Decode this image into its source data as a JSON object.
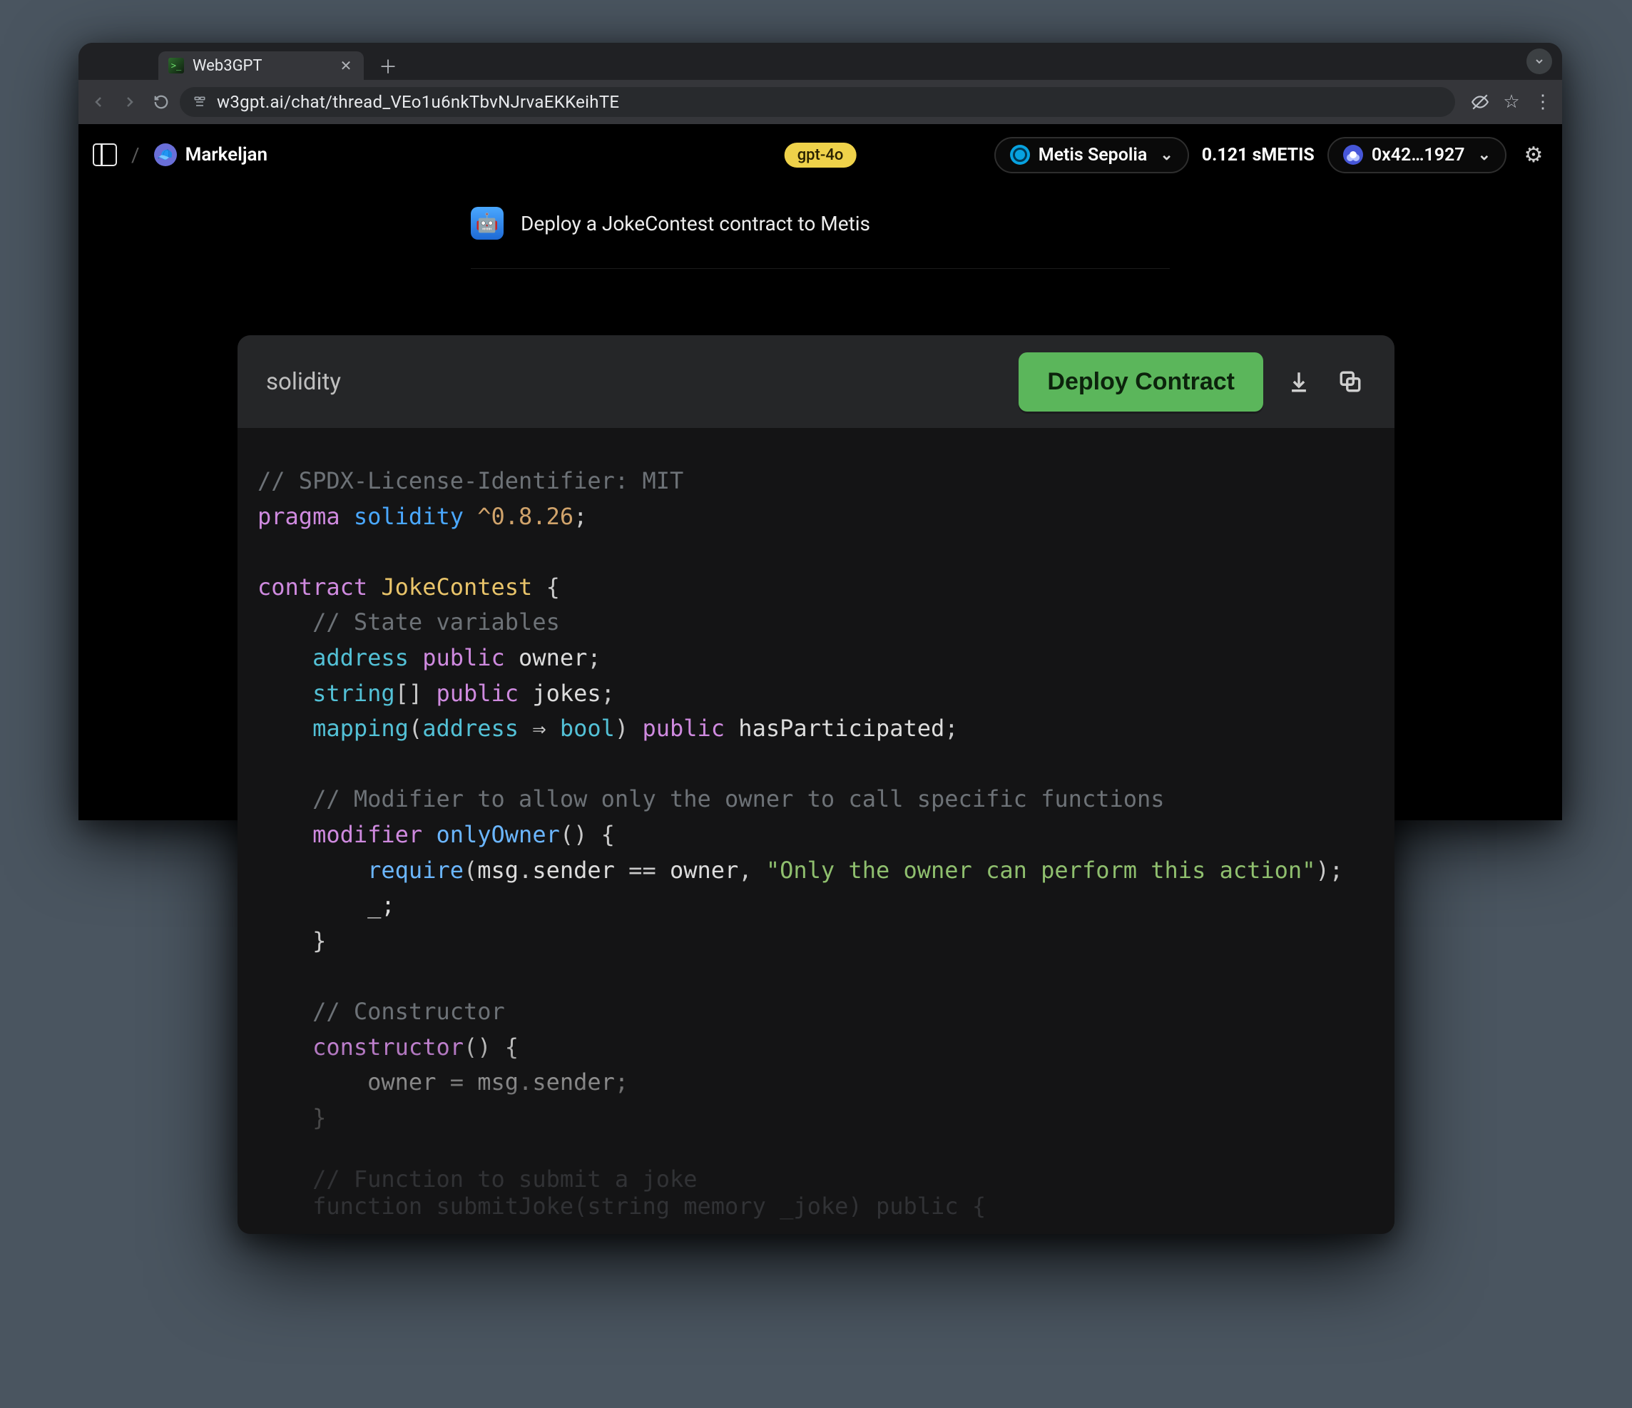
{
  "browser": {
    "tab_title": "Web3GPT",
    "url": "w3gpt.ai/chat/thread_VEo1u6nkTbvNJrvaEKKeihTE"
  },
  "app": {
    "username": "Markeljan",
    "model_badge": "gpt-4o",
    "network": "Metis Sepolia",
    "balance": "0.121 sMETIS",
    "wallet": "0x42…1927"
  },
  "chat": {
    "user_message": "Deploy a JokeContest contract to Metis"
  },
  "code_panel": {
    "lang": "solidity",
    "deploy_label": "Deploy Contract"
  },
  "code": {
    "l01": "// SPDX-License-Identifier: MIT",
    "l02a": "pragma",
    "l02b": "solidity",
    "l02c": "^0.8.26",
    "l04a": "contract",
    "l04b": "JokeContest",
    "l05": "    // State variables",
    "l06a": "address",
    "l06b": "public",
    "l06c": "owner",
    "l07a": "string",
    "l07b": "public",
    "l07c": "jokes",
    "l08a": "mapping",
    "l08b": "address",
    "l08c": "bool",
    "l08d": "public",
    "l08e": "hasParticipated",
    "l10": "    // Modifier to allow only the owner to call specific functions",
    "l11a": "modifier",
    "l11b": "onlyOwner",
    "l12a": "require",
    "l12b": "msg",
    "l12c": "sender",
    "l12d": "owner",
    "l12e": "\"Only the owner can perform this action\"",
    "l13": "        _;",
    "l16": "    // Constructor",
    "l17a": "constructor",
    "l18a": "owner",
    "l18b": "msg",
    "l18c": "sender",
    "faint1": "    // Function to submit a joke",
    "faint2": "    function submitJoke(string memory _joke) public {"
  }
}
